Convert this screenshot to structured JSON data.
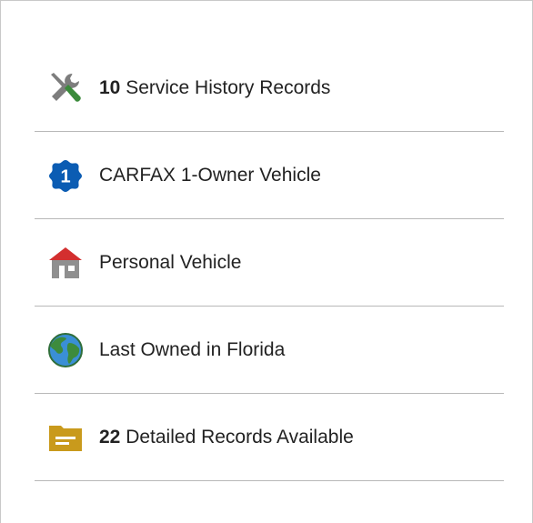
{
  "items": [
    {
      "icon": "wrench-screwdriver-icon",
      "count": "10",
      "text": " Service History Records"
    },
    {
      "icon": "one-owner-badge-icon",
      "badge": "1",
      "count": "",
      "text": "CARFAX 1-Owner Vehicle"
    },
    {
      "icon": "house-icon",
      "count": "",
      "text": "Personal Vehicle"
    },
    {
      "icon": "globe-icon",
      "count": "",
      "text": "Last Owned in Florida"
    },
    {
      "icon": "folder-icon",
      "count": "22",
      "text": " Detailed Records Available"
    }
  ],
  "colors": {
    "tool_gray": "#7d7d7d",
    "tool_green": "#3a8a3a",
    "badge_blue": "#0b5cb3",
    "house_red": "#d32f2f",
    "house_gray": "#8f8f8f",
    "globe_blue": "#3a8fd6",
    "globe_green": "#3d8b3d",
    "folder_gold": "#c99a1c"
  }
}
